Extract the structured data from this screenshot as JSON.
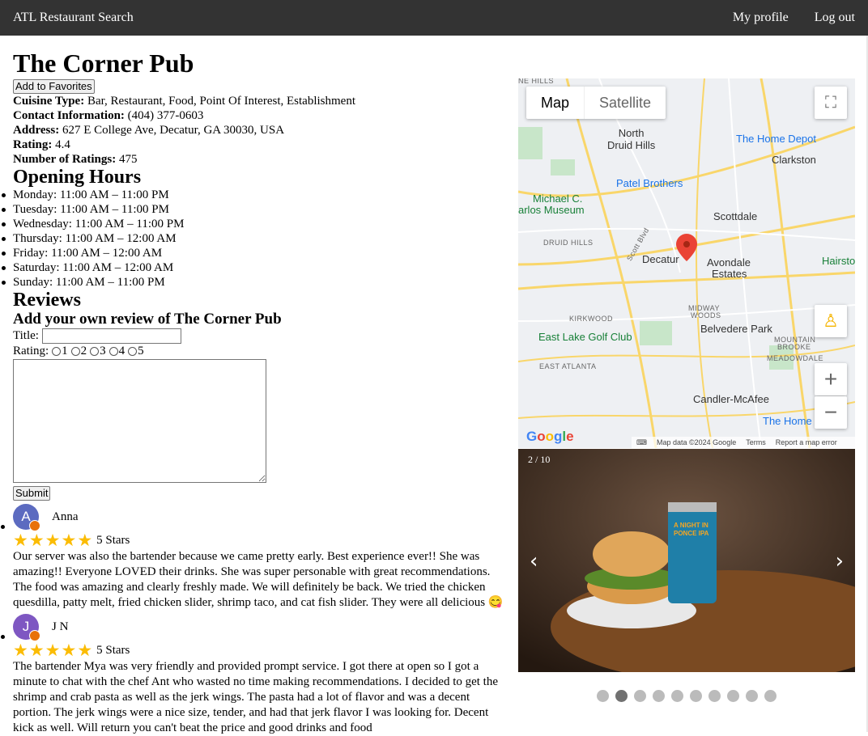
{
  "topbar": {
    "brand": "ATL Restaurant Search",
    "profile": "My profile",
    "logout": "Log out"
  },
  "restaurant": {
    "name": "The Corner Pub",
    "favorite_button": "Add to Favorites",
    "cuisine_label": "Cuisine Type:",
    "cuisine": "Bar, Restaurant, Food, Point Of Interest, Establishment",
    "contact_label": "Contact Information:",
    "contact": "(404) 377-0603",
    "address_label": "Address:",
    "address": "627 E College Ave, Decatur, GA 30030, USA",
    "rating_label": "Rating:",
    "rating": "4.4",
    "num_ratings_label": "Number of Ratings:",
    "num_ratings": "475"
  },
  "hours": {
    "heading": "Opening Hours",
    "days": [
      "Monday: 11:00 AM – 11:00 PM",
      "Tuesday: 11:00 AM – 11:00 PM",
      "Wednesday: 11:00 AM – 11:00 PM",
      "Thursday: 11:00 AM – 12:00 AM",
      "Friday: 11:00 AM – 12:00 AM",
      "Saturday: 11:00 AM – 12:00 AM",
      "Sunday: 11:00 AM – 11:00 PM"
    ]
  },
  "reviews": {
    "heading": "Reviews",
    "form_heading": "Add your own review of The Corner Pub",
    "title_label": "Title:",
    "rating_label": "Rating:",
    "rating_options": [
      "1",
      "2",
      "3",
      "4",
      "5"
    ],
    "submit": "Submit",
    "items": [
      {
        "initial": "A",
        "avatar_color": "#5c6bc0",
        "name": "Anna",
        "stars": 5,
        "stars_label": "5 Stars",
        "text": "Our server was also the bartender because we came pretty early. Best experience ever!! She was amazing!! Everyone LOVED their drinks. She was super personable with great recommendations. The food was amazing and clearly freshly made. We will definitely be back. We tried the chicken quesdilla, patty melt, fried chicken slider, shrimp taco, and cat fish slider. They were all delicious 😋"
      },
      {
        "initial": "J",
        "avatar_color": "#7e57c2",
        "name": "J N",
        "stars": 5,
        "stars_label": "5 Stars",
        "text": "The bartender Mya was very friendly and provided prompt service. I got there at open so I got a minute to chat with the chef Ant who wasted no time making recommendations. I decided to get the shrimp and crab pasta as well as the jerk wings. The pasta had a lot of flavor and was a decent portion. The jerk wings were a nice size, tender, and had that jerk flavor I was looking for. Decent kick as well. Will return you can't beat the price and good drinks and food"
      }
    ]
  },
  "map": {
    "tab_map": "Map",
    "tab_satellite": "Satellite",
    "labels": {
      "north_druid_hills": "North\nDruid Hills",
      "home_depot": "The Home Depot",
      "clarkston": "Clarkston",
      "patel": "Patel Brothers",
      "michael_c": "Michael C.",
      "carlos_museum": "arlos Museum",
      "scottdale": "Scottdale",
      "druid_hills": "DRUID HILLS",
      "decatur": "Decatur",
      "avondale": "Avondale",
      "estates": "Estates",
      "hairston": "Hairsto",
      "midway": "MIDWAY",
      "woods": "WOODS",
      "kirkwood": "KIRKWOOD",
      "east_lake": "East Lake Golf Club",
      "belvedere": "Belvedere Park",
      "mountain": "MOUNTAIN",
      "brooke": "BROOKE",
      "meadowdale": "MEADOWDALE",
      "east_atlanta": "EAST ATLANTA",
      "candler": "Candler-McAfee",
      "home2": "The Home",
      "scott_blvd": "Scott Blvd",
      "ne_hills": "NE HILLS"
    },
    "footer_data": "Map data ©2024 Google",
    "footer_terms": "Terms",
    "footer_report": "Report a map error",
    "logo": "Google"
  },
  "carousel": {
    "counter": "2 / 10",
    "prev": "‹",
    "next": "›",
    "total": 10,
    "active_index": 1,
    "can_text": "A NIGHT IN PONCE IPA"
  }
}
